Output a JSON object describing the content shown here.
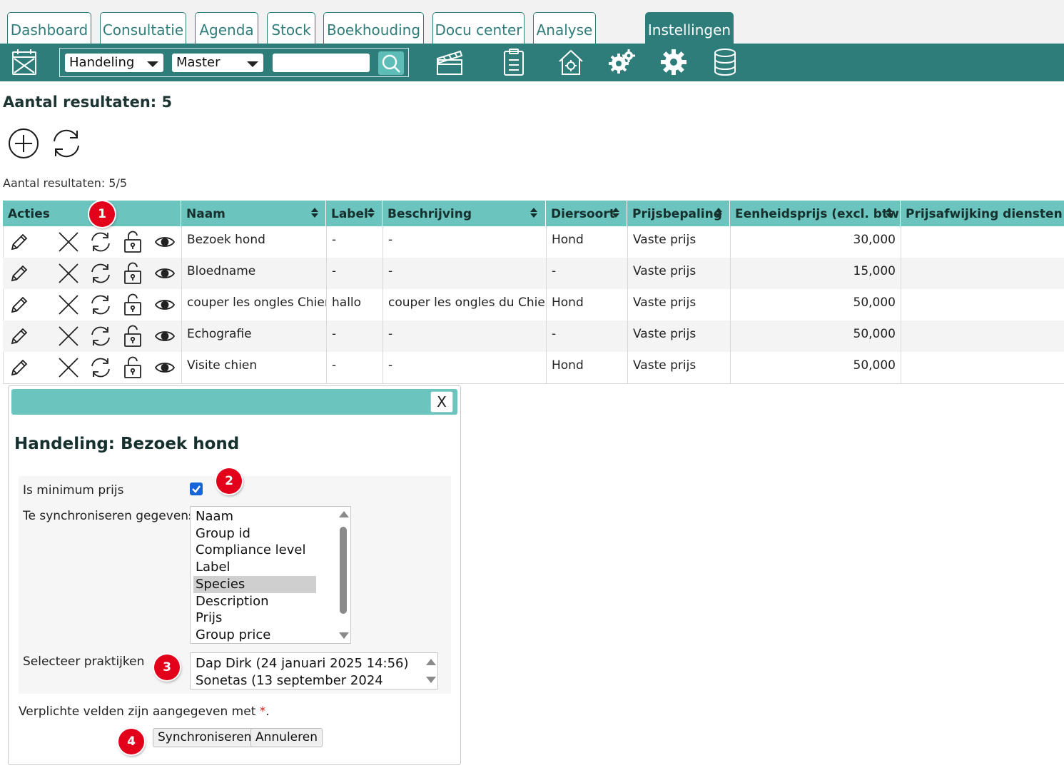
{
  "tabs": [
    {
      "label": "Dashboard"
    },
    {
      "label": "Consultatie"
    },
    {
      "label": "Agenda"
    },
    {
      "label": "Stock"
    },
    {
      "label": "Boekhouding"
    },
    {
      "label": "Docu center"
    },
    {
      "label": "Analyse"
    },
    {
      "label": "Instellingen",
      "active": true
    }
  ],
  "toolbar": {
    "type_select": "Handeling",
    "scope_select": "Master",
    "search_value": "",
    "icons": [
      "calendar-x-icon",
      "search-icon",
      "clapperboard-icon",
      "clipboard-icon",
      "house-gear-icon",
      "gears-icon",
      "gear-icon",
      "database-icon"
    ]
  },
  "results": {
    "heading": "Aantal resultaten: 5",
    "summary": "Aantal resultaten: 5/5"
  },
  "table": {
    "headers": [
      "Acties",
      "Naam",
      "Label",
      "Beschrijving",
      "Diersoort",
      "Prijsbepaling",
      "Eenheidsprijs (excl. btw)",
      "Prijsafwijking diensten (%)"
    ],
    "rows": [
      {
        "naam": "Bezoek hond",
        "label": "-",
        "beschrijving": "-",
        "diersoort": "Hond",
        "prijsbepaling": "Vaste prijs",
        "eenheidsprijs": "30,000",
        "prijsafwijking": ""
      },
      {
        "naam": "Bloedname",
        "label": "-",
        "beschrijving": "-",
        "diersoort": "-",
        "prijsbepaling": "Vaste prijs",
        "eenheidsprijs": "15,000",
        "prijsafwijking": ""
      },
      {
        "naam": "couper les ongles Chien",
        "label": "hallo",
        "beschrijving": "couper les ongles du Chien",
        "diersoort": "Hond",
        "prijsbepaling": "Vaste prijs",
        "eenheidsprijs": "50,000",
        "prijsafwijking": ""
      },
      {
        "naam": "Echografie",
        "label": "-",
        "beschrijving": "-",
        "diersoort": "-",
        "prijsbepaling": "Vaste prijs",
        "eenheidsprijs": "50,000",
        "prijsafwijking": ""
      },
      {
        "naam": "Visite chien",
        "label": "-",
        "beschrijving": "-",
        "diersoort": "Hond",
        "prijsbepaling": "Vaste prijs",
        "eenheidsprijs": "50,000",
        "prijsafwijking": ""
      }
    ]
  },
  "markers": [
    "1",
    "2",
    "3",
    "4"
  ],
  "dialog": {
    "close_label": "X",
    "title": "Handeling: Bezoek hond",
    "min_price_label": "Is minimum prijs",
    "min_price_checked": true,
    "sync_label": "Te synchroniseren gegevens",
    "sync_options": [
      "Naam",
      "Group id",
      "Compliance level",
      "Label",
      "Species",
      "Description",
      "Prijs",
      "Group price category"
    ],
    "sync_selected": "Species",
    "practices_label": "Selecteer praktijken",
    "practices": [
      "Dap Dirk (24 januari 2025 14:56)",
      "Sonetas (13 september 2024 11:56)"
    ],
    "required_note": "Verplichte velden zijn aangegeven met",
    "required_mark": "*",
    "required_end": ".",
    "sync_button": "Synchroniseren",
    "cancel_button": "Annuleren"
  },
  "colors": {
    "brand": "#2e7d7a",
    "header": "#6cc4be",
    "marker": "#e3001b",
    "checkbox": "#1565d8"
  }
}
